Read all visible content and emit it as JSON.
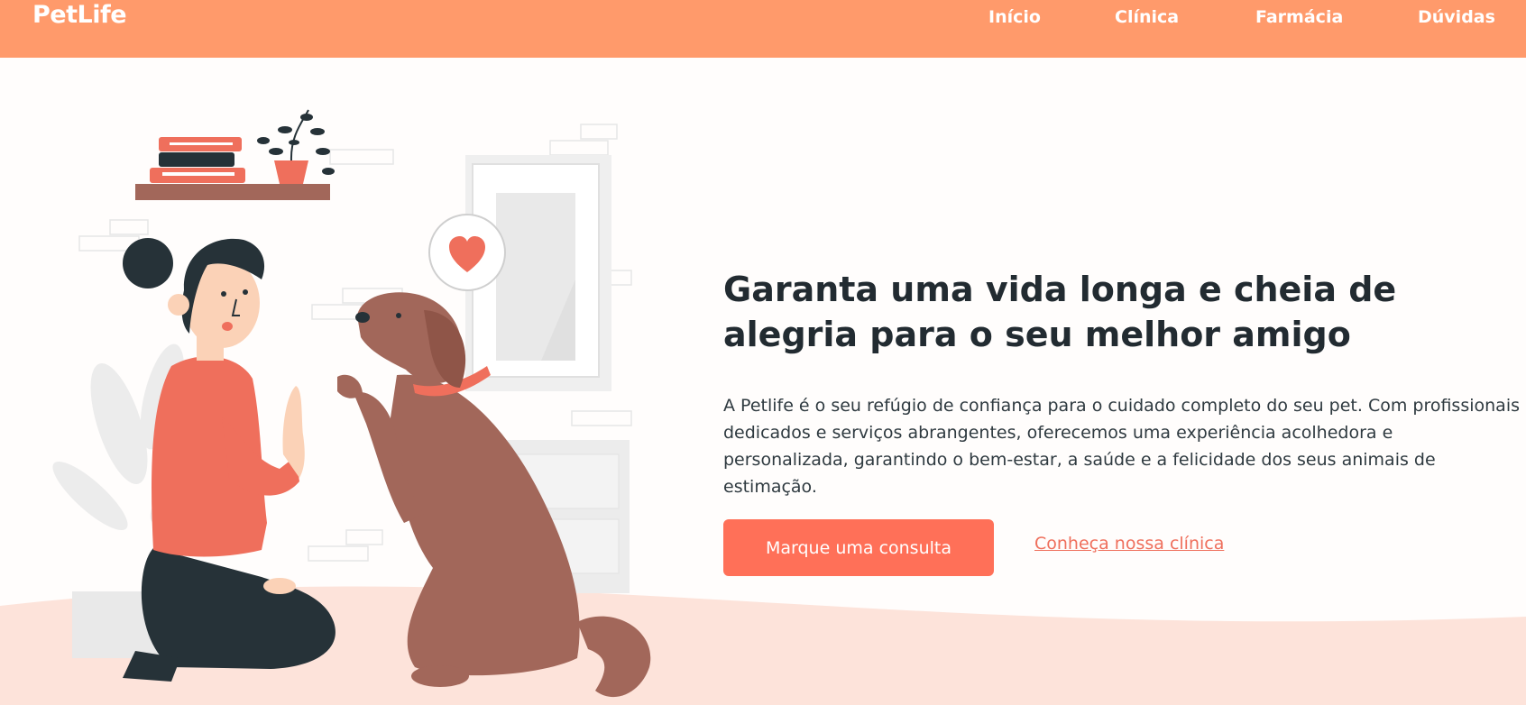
{
  "header": {
    "logo": "PetLife",
    "nav": [
      {
        "label": "Início"
      },
      {
        "label": "Clínica"
      },
      {
        "label": "Farmácia"
      },
      {
        "label": "Dúvidas"
      }
    ]
  },
  "hero": {
    "title": "Garanta uma vida longa e cheia de alegria para o seu melhor amigo",
    "description": "A Petlife é o seu refúgio de confiança para o cuidado completo do seu pet. Com profissionais dedicados e serviços abrangentes, oferecemos uma experiência acolhedora e personalizada, garantindo o bem-estar, a saúde e a felicidade dos seus animais de estimação.",
    "primary_button": "Marque uma consulta",
    "secondary_link": "Conheça nossa clínica"
  },
  "colors": {
    "navbar": "#ff9a6b",
    "accent": "#ff7058",
    "text": "#222b31",
    "floor": "#fde3da"
  },
  "illustration": {
    "subject": "woman-high-five-dog",
    "icons": [
      "heart-icon",
      "books-icon",
      "plant-icon"
    ]
  }
}
